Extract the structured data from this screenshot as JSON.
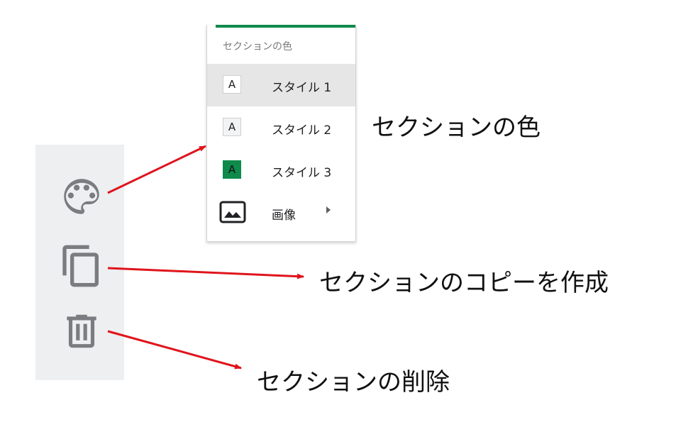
{
  "menu": {
    "header": "セクションの色",
    "items": [
      {
        "label": "スタイル 1",
        "swatch_text": "A",
        "swatch_bg": "#ffffff",
        "swatch_fg": "#202124",
        "selected": true
      },
      {
        "label": "スタイル 2",
        "swatch_text": "A",
        "swatch_bg": "#f1f3f4",
        "swatch_fg": "#202124",
        "selected": false
      },
      {
        "label": "スタイル 3",
        "swatch_text": "A",
        "swatch_bg": "#0f8a4b",
        "swatch_fg": "#111111",
        "selected": false
      }
    ],
    "image_item": {
      "label": "画像",
      "icon": "image-icon",
      "has_submenu": true
    },
    "accent_color": "#0f8a4b"
  },
  "toolbar": {
    "buttons": [
      {
        "icon": "palette-icon"
      },
      {
        "icon": "copy-icon"
      },
      {
        "icon": "trash-icon"
      }
    ],
    "icon_color": "#7a7d80"
  },
  "callouts": {
    "color": "セクションの色",
    "copy": "セクションのコピーを作成",
    "delete": "セクションの削除"
  },
  "arrow_color": "#e0141c"
}
